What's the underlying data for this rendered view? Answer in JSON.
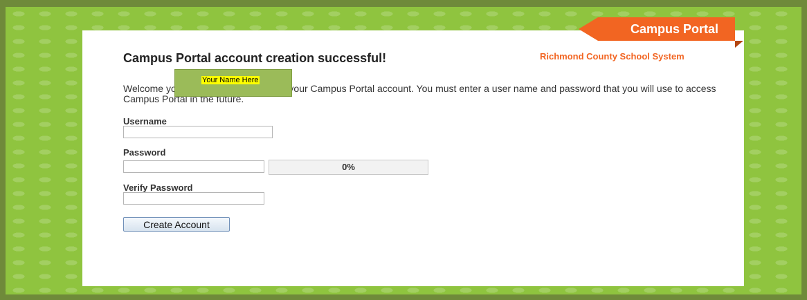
{
  "header": {
    "badge": "Campus Portal",
    "district": "Richmond County School System"
  },
  "main": {
    "title": "Campus Portal account creation successful!",
    "welcome_text": "Welcome                                    you are now ready to create your Campus Portal account. You must enter a user name and password that you will use to access Campus Portal in the future.",
    "name_placeholder_tag": "Your Name Here"
  },
  "form": {
    "username_label": "Username",
    "username_value": "",
    "password_label": "Password",
    "password_value": "",
    "strength_text": "0%",
    "strength_fraction": 0,
    "verify_label": "Verify Password",
    "verify_value": "",
    "submit_label": "Create Account"
  },
  "colors": {
    "accent": "#f26522",
    "background_green": "#8fc43f",
    "frame_dark": "#6f8a3a"
  }
}
